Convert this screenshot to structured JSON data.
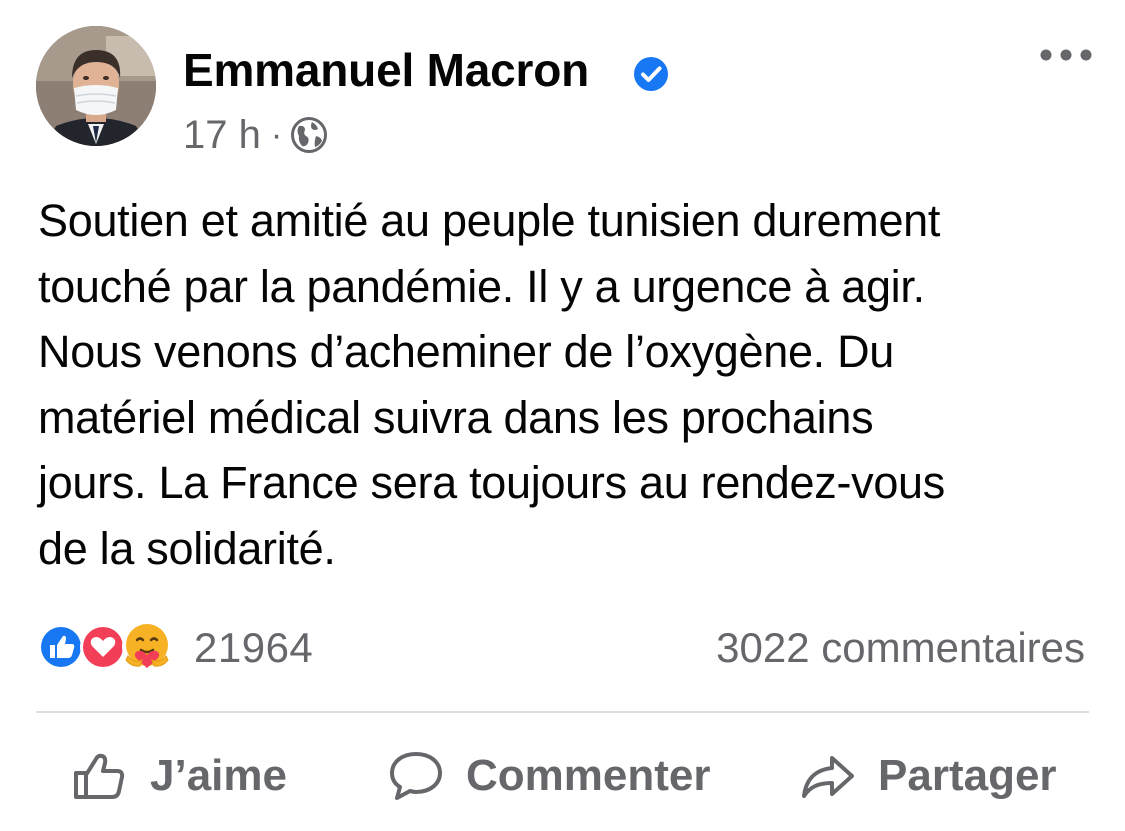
{
  "post": {
    "author": "Emmanuel Macron",
    "verified": true,
    "timestamp": "17 h",
    "separator": "·",
    "audience_icon": "globe-icon",
    "more_icon": "more-horizontal-icon",
    "text": "Soutien et amitié au peuple tunisien durement\ntouché par la pandémie. Il y a urgence à agir.\nNous venons d’acheminer de l’oxygène. Du\nmatériel médical suivra dans les prochains\njours. La France sera toujours au rendez-vous\nde la solidarité."
  },
  "stats": {
    "reaction_icons": [
      "like-icon",
      "love-icon",
      "care-icon"
    ],
    "reaction_count": "21964",
    "comment_count": "3022 commentaires"
  },
  "actions": {
    "like_label": "J’aime",
    "comment_label": "Commenter",
    "share_label": "Partager"
  },
  "colors": {
    "text_primary": "#050505",
    "text_secondary": "#65676b",
    "verified_blue": "#1877f2",
    "like_blue": "#1877f2",
    "love_red": "#f33e58",
    "care_yellow": "#f7b125",
    "divider": "#dadde1"
  }
}
